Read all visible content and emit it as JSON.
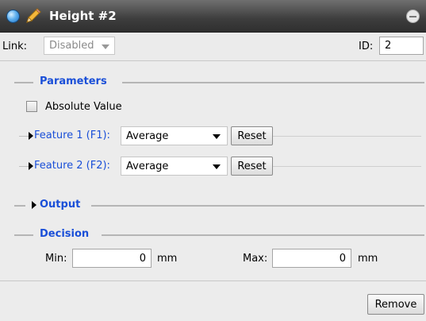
{
  "window": {
    "title": "Height #2"
  },
  "link_bar": {
    "label": "Link:",
    "selected": "Disabled",
    "id_label": "ID:",
    "id_value": "2"
  },
  "parameters": {
    "heading": "Parameters",
    "absolute_value": {
      "label": "Absolute Value",
      "checked": false
    },
    "features": [
      {
        "label": "Feature 1 (F1):",
        "selected": "Average",
        "reset_label": "Reset"
      },
      {
        "label": "Feature 2 (F2):",
        "selected": "Average",
        "reset_label": "Reset"
      }
    ]
  },
  "output": {
    "heading": "Output"
  },
  "decision": {
    "heading": "Decision",
    "min_label": "Min:",
    "min_value": "0",
    "max_label": "Max:",
    "max_value": "0",
    "unit": "mm"
  },
  "footer": {
    "remove_label": "Remove"
  },
  "colors": {
    "accent": "#1a4fd8",
    "titlebar": "#3d3d3d"
  }
}
